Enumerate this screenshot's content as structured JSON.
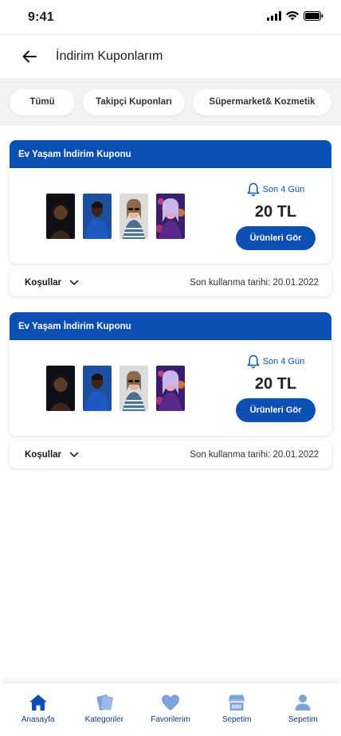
{
  "status_bar": {
    "time": "9:41"
  },
  "header": {
    "title": "İndirim Kuponlarım"
  },
  "filters": [
    {
      "label": "Tümü"
    },
    {
      "label": "Takipçi Kuponları"
    },
    {
      "label": "Süpermarket& Kozmetik"
    }
  ],
  "coupons": [
    {
      "title": "Ev Yaşam İndirim Kuponu",
      "days_left": "Son 4 Gün",
      "amount": "20 TL",
      "button_label": "Ürünleri Gör",
      "conditions_label": "Koşullar",
      "expiry": "Son kullanma tarihi: 20.01.2022"
    },
    {
      "title": "Ev Yaşam İndirim Kuponu",
      "days_left": "Son 4 Gün",
      "amount": "20 TL",
      "button_label": "Ürünleri Gör",
      "conditions_label": "Koşullar",
      "expiry": "Son kullanma tarihi: 20.01.2022"
    }
  ],
  "tab_bar": [
    {
      "label": "Anasayfa",
      "icon": "home-icon"
    },
    {
      "label": "Kategoriler",
      "icon": "categories-icon"
    },
    {
      "label": "Favorilerim",
      "icon": "heart-icon"
    },
    {
      "label": "Sepetim",
      "icon": "store-icon"
    },
    {
      "label": "Sepetim",
      "icon": "user-icon"
    }
  ],
  "colors": {
    "primary": "#0a4fb1",
    "filter_bg": "#f3f3f3",
    "tab_active": "#0a4fb1",
    "tab_inactive": "#7ea3dc"
  }
}
